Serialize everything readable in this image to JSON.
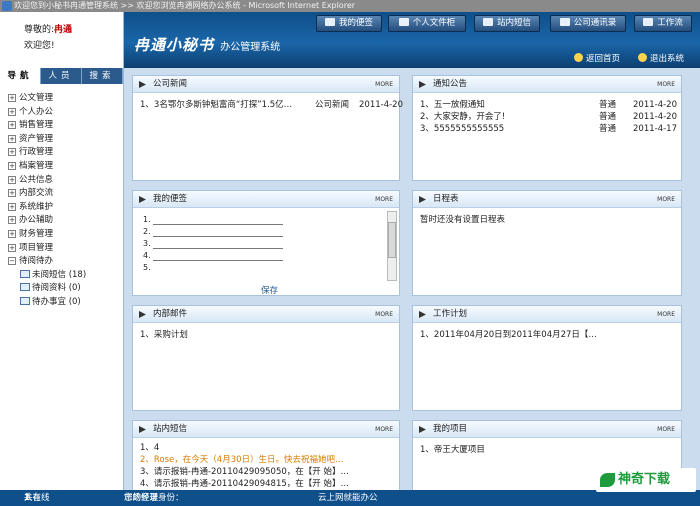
{
  "window": {
    "title": "欢迎您到小秘书冉通管理系统 >> 欢迎您浏览冉通网络办公系统 - Microsoft Internet Explorer"
  },
  "welcome": {
    "greeting": "尊敬的:",
    "user": "冉通",
    "line2": "欢迎您!"
  },
  "header": {
    "brand": "冉通小秘书",
    "brand_sub": "办公管理系统",
    "buttons": [
      "我的便签",
      "个人文件柜",
      "站内短信",
      "公司通讯录",
      "工作流"
    ],
    "links": [
      "返回首页",
      "退出系统"
    ]
  },
  "sidebar": {
    "tabs": [
      "导航",
      "人员",
      "搜索"
    ],
    "items": [
      "公文管理",
      "个人办公",
      "销售管理",
      "资产管理",
      "行政管理",
      "档案管理",
      "公共信息",
      "内部交流",
      "系统维护",
      "办公辅助",
      "财务管理",
      "项目管理",
      "待阅待办"
    ],
    "children": [
      "未阅短信 (18)",
      "待阅资料 (0)",
      "待办事宜 (0)"
    ]
  },
  "panels": {
    "more": "MORE",
    "news": {
      "title": "公司新闻",
      "rows": [
        {
          "text": "1、3名鄂尔多斯钟魁富商“打探”1.5亿…",
          "cat": "公司新闻",
          "date": "2011-4-20"
        }
      ]
    },
    "notice": {
      "title": "通知公告",
      "rows": [
        {
          "text": "1、五一放假通知",
          "cat": "普通",
          "date": "2011-4-20"
        },
        {
          "text": "2、大家安静，开会了!",
          "cat": "普通",
          "date": "2011-4-20"
        },
        {
          "text": "3、5555555555555",
          "cat": "普通",
          "date": "2011-4-17"
        }
      ]
    },
    "memo": {
      "title": "我的便签",
      "lines": [
        "1.",
        "2.",
        "3.",
        "4.",
        "5."
      ],
      "save": "保存"
    },
    "schedule": {
      "title": "日程表",
      "rows": [
        "暂时还没有设置日程表"
      ]
    },
    "mail": {
      "title": "内部邮件",
      "rows": [
        "1、采购计划"
      ]
    },
    "plan": {
      "title": "工作计划",
      "rows": [
        "1、2011年04月20日到2011年04月27日【…"
      ]
    },
    "sms": {
      "title": "站内短信",
      "rows": [
        "1、4",
        "2、Rose，在今天（4月30日）生日。快去祝福她吧…",
        "3、请示报销-冉通-20110429095050，在【开 始】…",
        "4、请示报销-冉通-20110429094815，在【开 始】…"
      ]
    },
    "project": {
      "title": "我的项目",
      "rows": [
        "1、帝王大厦项目"
      ]
    }
  },
  "status": {
    "online_prefix": "共有",
    "online_count": "1",
    "online_suffix": "人在线",
    "identity_label": "您的登录身份：",
    "identity": "市场经理",
    "slogan": "云上网就能办公"
  },
  "watermark": "神奇下载"
}
